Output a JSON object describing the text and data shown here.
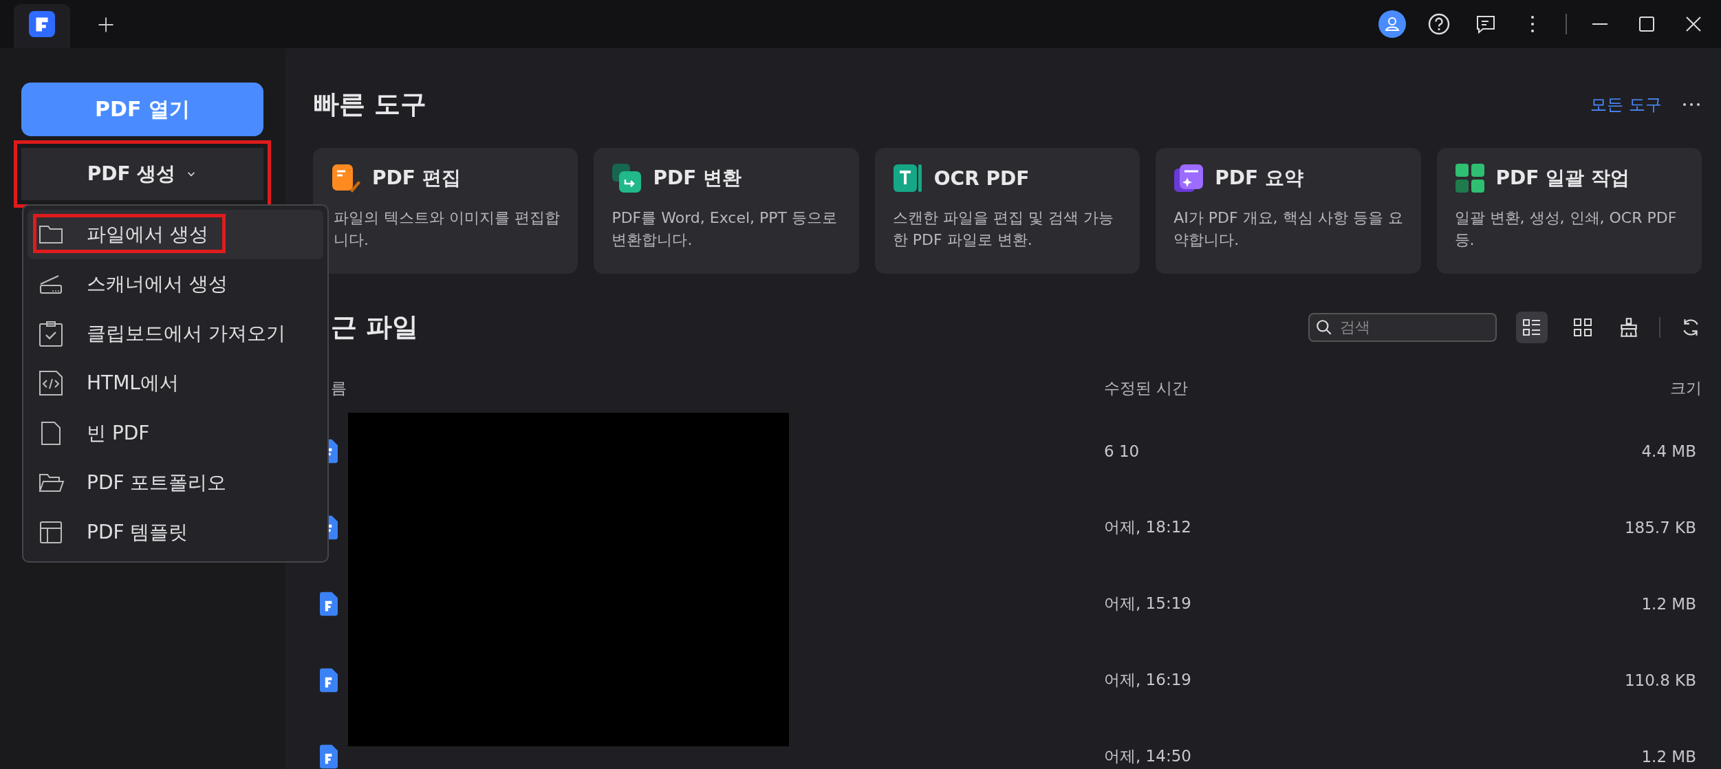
{
  "sidebar": {
    "open_button": "PDF 열기",
    "create_button": {
      "label": "PDF 생성",
      "expanded": true,
      "highlighted": true
    }
  },
  "create_menu": [
    {
      "kind": "folder",
      "label": "파일에서 생성",
      "selected": true,
      "highlighted": true
    },
    {
      "kind": "scanner",
      "label": "스캐너에서 생성",
      "selected": false,
      "highlighted": false
    },
    {
      "kind": "clipboard",
      "label": "클립보드에서 가져오기",
      "selected": false,
      "highlighted": false
    },
    {
      "kind": "html",
      "label": "HTML에서",
      "selected": false,
      "highlighted": false
    },
    {
      "kind": "blank",
      "label": "빈 PDF",
      "selected": false,
      "highlighted": false
    },
    {
      "kind": "portfolio",
      "label": "PDF 포트폴리오",
      "selected": false,
      "highlighted": false
    },
    {
      "kind": "template",
      "label": "PDF 템플릿",
      "selected": false,
      "highlighted": false
    }
  ],
  "quick_tools": {
    "title": "빠른 도구",
    "all_link": "모든 도구",
    "cards": [
      {
        "kind": "edit",
        "title": "PDF 편집",
        "description": "파일의 텍스트와 이미지를 편집합니다."
      },
      {
        "kind": "convert",
        "title": "PDF 변환",
        "description": "PDF를 Word, Excel, PPT 등으로 변환합니다."
      },
      {
        "kind": "ocr",
        "title": "OCR PDF",
        "description": "스캔한 파일을 편집 및 검색 가능한 PDF 파일로 변환."
      },
      {
        "kind": "summary",
        "title": "PDF 요약",
        "description": "AI가 PDF 개요, 핵심 사항 등을 요약합니다."
      },
      {
        "kind": "batch",
        "title": "PDF 일괄 작업",
        "description": "일괄 변환, 생성, 인쇄, OCR PDF 등."
      }
    ]
  },
  "recent_files": {
    "title": "근 파일",
    "search": {
      "placeholder": "검색"
    },
    "views": [
      {
        "kind": "list",
        "selected": true
      },
      {
        "kind": "grid",
        "selected": false
      }
    ],
    "columns": [
      "름",
      "수정된 시간",
      "크기"
    ],
    "names_redacted": true,
    "rows": [
      {
        "modified": "6 10",
        "size": "4.4 MB"
      },
      {
        "modified": "어제, 18:12",
        "size": "185.7 KB"
      },
      {
        "modified": "어제, 15:19",
        "size": "1.2 MB"
      },
      {
        "modified": "어제, 16:19",
        "size": "110.8 KB"
      },
      {
        "modified": "어제, 14:50",
        "size": "1.2 MB"
      }
    ]
  }
}
